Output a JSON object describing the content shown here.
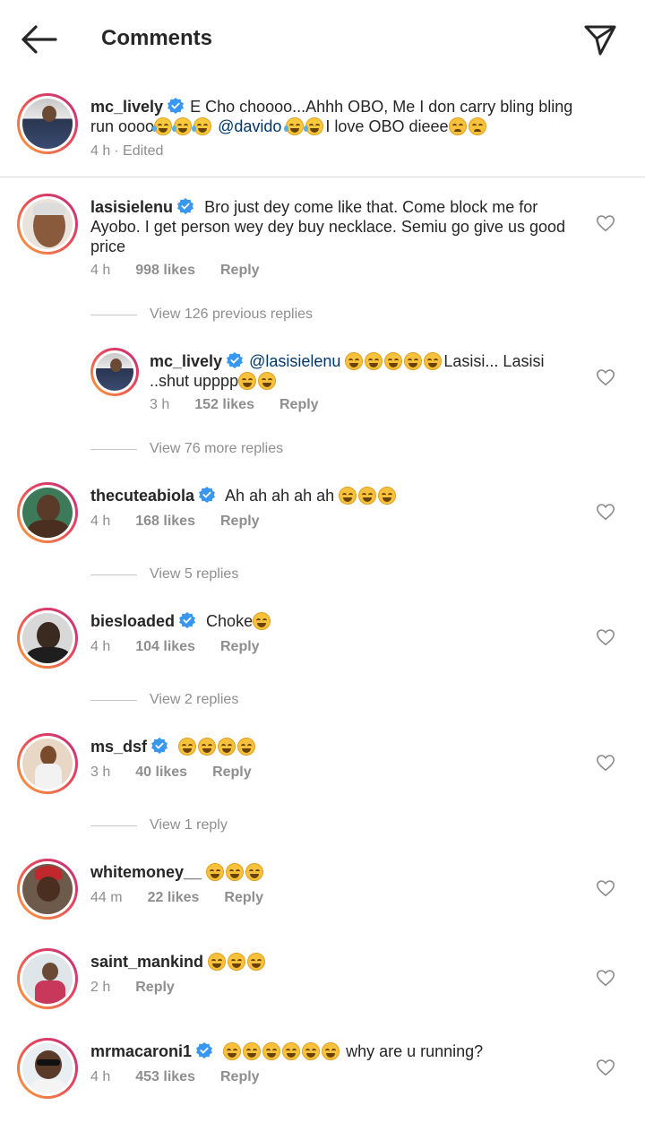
{
  "header": {
    "title": "Comments",
    "back_icon": "arrow-left-icon",
    "share_icon": "paper-plane-icon"
  },
  "caption": {
    "username": "mc_lively",
    "text_1": "E Cho choooo...Ahhh OBO, Me I don carry bling bling run oooo",
    "mention": "@davido",
    "text_2": "I love OBO dieee",
    "time": "4 h",
    "edited": "· Edited"
  },
  "comments": [
    {
      "username": "lasisielenu",
      "text": "Bro just dey come like that. Come block me for Ayobo. I get person wey dey buy necklace. Semiu go give us good price",
      "time": "4 h",
      "likes": "998 likes",
      "reply": "Reply"
    },
    {
      "username": "mc_lively",
      "mention": "@lasisielenu",
      "text_after": "Lasisi... Lasisi ..shut upppp",
      "time": "3 h",
      "likes": "152 likes",
      "reply": "Reply"
    },
    {
      "username": "thecuteabiola",
      "text": "Ah ah ah ah ah",
      "time": "4 h",
      "likes": "168 likes",
      "reply": "Reply"
    },
    {
      "username": "biesloaded",
      "text": "Choke",
      "time": "4 h",
      "likes": "104 likes",
      "reply": "Reply"
    },
    {
      "username": "ms_dsf",
      "text": "",
      "time": "3 h",
      "likes": "40 likes",
      "reply": "Reply"
    },
    {
      "username": "whitemoney__",
      "text": "",
      "time": "44 m",
      "likes": "22 likes",
      "reply": "Reply"
    },
    {
      "username": "saint_mankind",
      "text": "",
      "time": "2 h",
      "likes": "",
      "reply": "Reply"
    },
    {
      "username": "mrmacaroni1",
      "text": "why are u running?",
      "time": "4 h",
      "likes": "453 likes",
      "reply": "Reply"
    }
  ],
  "view_replies": {
    "r1": "View 126 previous replies",
    "r2": "View 76 more replies",
    "r3": "View 5 replies",
    "r4": "View 2 replies",
    "r5": "View 1 reply"
  },
  "colors": {
    "verified": "#3897f0",
    "meta": "#8e8e8e",
    "mention": "#00376b",
    "divider": "#dbdbdb"
  }
}
